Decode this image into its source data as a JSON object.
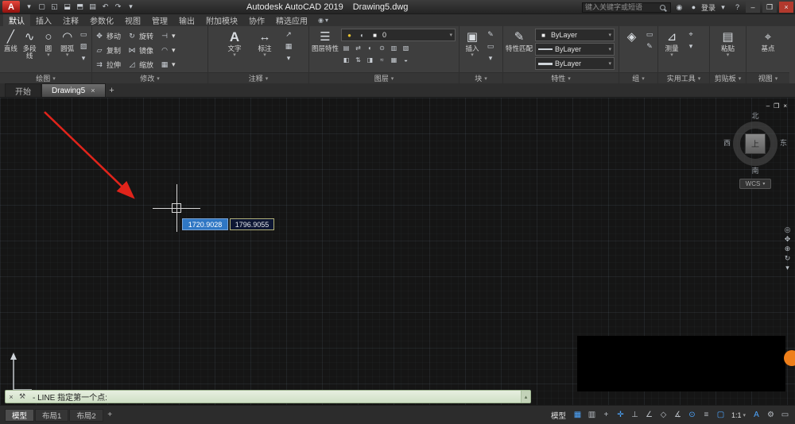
{
  "titlebar": {
    "app_title": "Autodesk AutoCAD 2019",
    "doc_title": "Drawing5.dwg",
    "search_placeholder": "键入关键字或短语",
    "signin": "登录"
  },
  "ribbon": {
    "tabs": [
      "默认",
      "插入",
      "注释",
      "参数化",
      "视图",
      "管理",
      "输出",
      "附加模块",
      "协作",
      "精选应用"
    ],
    "panels": {
      "draw": {
        "label": "绘图",
        "t0": "直线",
        "t1": "多段线",
        "t2": "圆",
        "t3": "圆弧"
      },
      "modify": {
        "label": "修改",
        "t0": "移动",
        "t1": "复制",
        "t2": "拉伸",
        "t3": "旋转",
        "t4": "镜像",
        "t5": "缩放"
      },
      "annotate": {
        "label": "注释",
        "t0": "文字",
        "t1": "标注"
      },
      "layers": {
        "label": "图层",
        "big": "图层特性",
        "current": "0",
        "r1": [
          "▤",
          "⇄",
          "◐",
          "⊙",
          "▥",
          "▧"
        ],
        "r2": [
          "◧",
          "⇅",
          "◨",
          "≈",
          "▦",
          "◒"
        ]
      },
      "block": {
        "label": "块",
        "t0": "插入"
      },
      "props": {
        "label": "特性",
        "big": "特性匹配",
        "v0": "ByLayer",
        "v1": "ByLayer",
        "v2": "ByLayer"
      },
      "group": {
        "label": "组"
      },
      "util": {
        "label": "实用工具",
        "t0": "测量"
      },
      "clip": {
        "label": "剪贴板",
        "t0": "粘贴"
      },
      "view": {
        "label": "视图",
        "t0": "基点"
      }
    }
  },
  "filetabs": {
    "start": "开始",
    "doc": "Drawing5"
  },
  "canvas": {
    "dyn_x": "1720.9028",
    "dyn_y": "1796.9055",
    "viewcube": {
      "n": "北",
      "s": "南",
      "e": "东",
      "w": "西",
      "top": "上",
      "wcs": "WCS"
    }
  },
  "cmdline": {
    "text": "-  LINE 指定第一个点:"
  },
  "statusbar": {
    "model_tab": "模型",
    "layout1": "布局1",
    "layout2": "布局2",
    "model_space": "模型",
    "scale": "1:1"
  },
  "colors": {
    "accent_blue": "#4da6ff",
    "arrow_red": "#e0241b",
    "cmd_green": "#dce9d3",
    "logo_red": "#c4160f"
  },
  "icons": {
    "app_logo": "A",
    "menu_caret": "▾",
    "new_file": "▢",
    "open_file": "◱",
    "save": "⬓",
    "save_as": "⬒",
    "plot": "▤",
    "undo": "↶",
    "redo": "↷",
    "help": "?",
    "win_min": "–",
    "win_restore": "❒",
    "win_close": "×",
    "doc_min": "–",
    "doc_restore": "❒",
    "doc_close": "×",
    "tab_close": "×",
    "tab_add": "+",
    "ribbon_style": "◉",
    "line": "╱",
    "polyline": "∿",
    "circle": "○",
    "arc": "◠",
    "rect": "▭",
    "hatch": "▨",
    "move": "✥",
    "copy": "▱",
    "stretch": "⇉",
    "rotate": "↻",
    "mirror": "⋈",
    "scale_t": "◿",
    "trim": "⊣",
    "fillet": "◠",
    "array": "▦",
    "text_t": "A",
    "dim": "↔",
    "leader": "↗",
    "table_t": "▦",
    "layer_props": "☰",
    "bulb": "●",
    "half": "◐",
    "swatch": "■",
    "insert_block": "▣",
    "block_small": "✎",
    "match_props": "✎",
    "group_t": "◈",
    "measure": "⊿",
    "paste": "▤",
    "base_point": "⌖",
    "gear": "⚙",
    "grid_t": "▦",
    "snap_t": "▥",
    "infer": "+",
    "dyn_t": "✛",
    "ortho": "⊥",
    "polar": "∠",
    "iso": "◇",
    "otrack": "∡",
    "osnap": "⊙",
    "lineweight": "≡",
    "sel_cycle": "▢",
    "annot": "A",
    "clean": "▭",
    "wheel": "◎",
    "pan": "✥",
    "zoom_t": "⊕",
    "orbit": "↻",
    "nav_caret": "▾",
    "wrench": "⚒",
    "cmd_close": "×",
    "scroll": "▴",
    "person": "●",
    "account": "◉"
  }
}
